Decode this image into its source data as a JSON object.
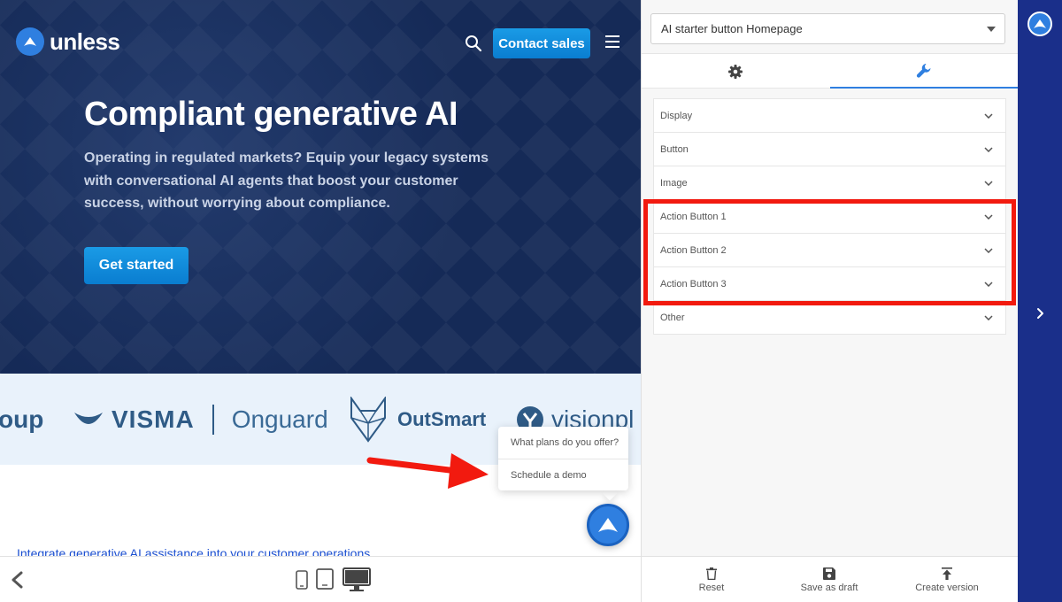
{
  "site": {
    "brand": "unless",
    "contact_label": "Contact sales",
    "hero_title": "Compliant generative AI",
    "hero_subtitle": "Operating in regulated markets? Equip your legacy systems with conversational AI agents that boost your customer success, without worrying about compliance.",
    "cta_label": "Get started",
    "logos": {
      "partial_left": "oup",
      "visma": "VISMA",
      "onguard": "Onguard",
      "outsmart": "OutSmart",
      "vision": "visionpl"
    },
    "integrate_link": "Integrate generative AI assistance into your customer operations"
  },
  "popup": {
    "items": [
      "What plans do you offer?",
      "Schedule a demo"
    ]
  },
  "panel": {
    "selected_experience": "AI starter button Homepage",
    "tabs": [
      {
        "icon": "gear-icon",
        "active": false
      },
      {
        "icon": "wrench-icon",
        "active": true
      }
    ],
    "sections": [
      "Display",
      "Button",
      "Image",
      "Action Button 1",
      "Action Button 2",
      "Action Button 3",
      "Other"
    ],
    "footer": {
      "reset": "Reset",
      "save_draft": "Save as draft",
      "create_version": "Create version"
    }
  },
  "colors": {
    "hero_bg": "#152a57",
    "accent": "#1a9be6",
    "rail_bg": "#1a2f8a",
    "annotation_red": "#f21a0f",
    "logo_blue": "#2f7fe0"
  }
}
